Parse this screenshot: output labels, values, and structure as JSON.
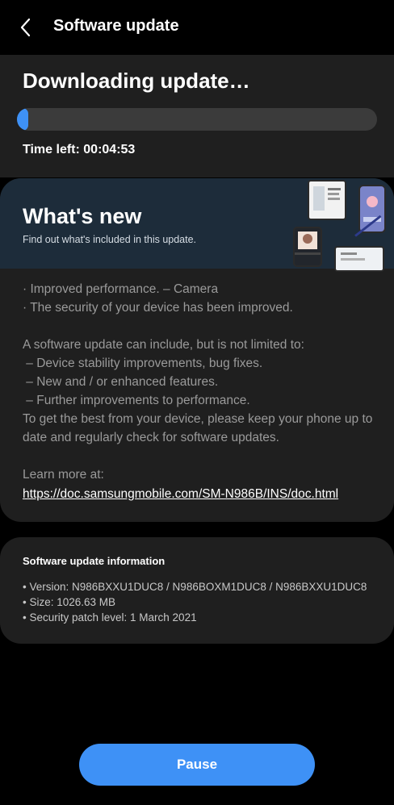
{
  "appbar": {
    "title": "Software update",
    "back_icon": "chevron-left-icon"
  },
  "download": {
    "heading": "Downloading update…",
    "progress_fraction": 0.03,
    "time_left": "Time left: 00:04:53"
  },
  "whats_new": {
    "title": "What's new",
    "subtitle": "Find out what's included in this update.",
    "changes": [
      "· Improved performance. – Camera",
      "· The security of your device has been improved."
    ],
    "intro": "A software update can include, but is not limited to:",
    "items": [
      " – Device stability improvements, bug fixes.",
      " – New and / or enhanced features.",
      " – Further improvements to performance."
    ],
    "advice": "To get the best from your device, please keep your phone up to date and regularly check for software updates.",
    "learn_more_label": "Learn more at:",
    "learn_more_url": "https://doc.samsungmobile.com/SM-N986B/INS/doc.html"
  },
  "info": {
    "title": "Software update information",
    "version": "• Version: N986BXXU1DUC8 / N986BOXM1DUC8 / N986BXXU1DUC8",
    "size": "• Size: 1026.63 MB",
    "security_patch": "• Security patch level: 1 March 2021"
  },
  "actions": {
    "pause_label": "Pause"
  },
  "colors": {
    "accent": "#3e91f6",
    "card": "#1f1f1f",
    "banner": "#1d2c3a"
  }
}
